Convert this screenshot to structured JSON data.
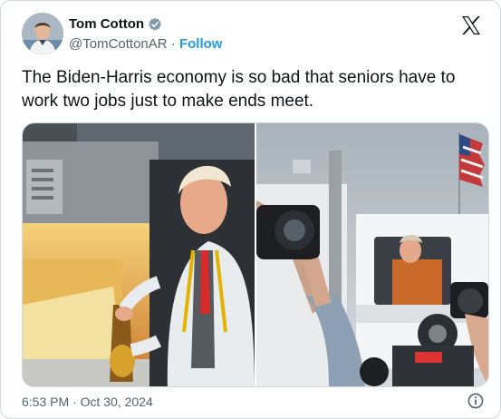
{
  "author": {
    "display_name": "Tom Cotton",
    "handle": "@TomCottonAR",
    "separator": "·",
    "follow_label": "Follow"
  },
  "tweet": {
    "text": "The Biden-Harris economy is so bad that seniors have to work two jobs just to make ends meet."
  },
  "media": {
    "count": 2
  },
  "footer": {
    "timestamp": "6:53 PM · Oct 30, 2024"
  },
  "icons": {
    "verified": "verified-badge-icon",
    "platform": "x-logo-icon",
    "info": "info-icon"
  },
  "colors": {
    "accent": "#1d9bf0",
    "secondary_text": "#536471",
    "border": "#cfd9de"
  }
}
